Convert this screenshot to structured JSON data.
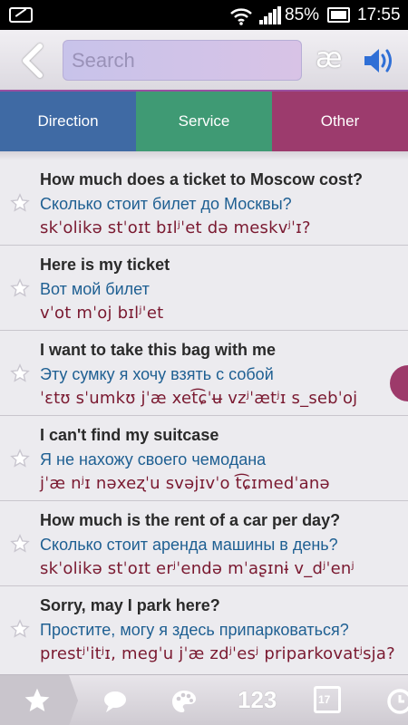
{
  "status_bar": {
    "battery_percent": "85%",
    "time": "17:55"
  },
  "toolbar": {
    "search_placeholder": "Search",
    "ipa_button_label": "æ"
  },
  "tabs": [
    {
      "label": "Direction",
      "color": "#3f6aa4"
    },
    {
      "label": "Service",
      "color": "#3f9a74"
    },
    {
      "label": "Other",
      "color": "#9c3b6d"
    }
  ],
  "phrases": [
    {
      "en": "How much does a ticket to Moscow cost?",
      "ru": "Сколько стоит билет до Москвы?",
      "tr": "skˈolikə stˈoɪt bɪlʲˈet də meskvʲˈɪ?"
    },
    {
      "en": "Here is my ticket",
      "ru": "Вот мой билет",
      "tr": "vˈot mˈoj bɪlʲˈet"
    },
    {
      "en": "I want to take this bag with me",
      "ru": "Эту сумку я хочу взять с собой",
      "tr": "ˈɛtʊ sˈumkʊ jˈæ xet͡ɕˈʉ vzʲˈætʲɪ s_sebˈoj"
    },
    {
      "en": "I can't find my suitcase",
      "ru": "Я не нахожу своего чемодана",
      "tr": "jˈæ nʲɪ nəxeʐˈu svəjɪvˈo t͡ɕɪmedˈanə"
    },
    {
      "en": "How much is the rent of a car per day?",
      "ru": "Сколько стоит аренда машины в день?",
      "tr": "skˈolikə stˈoɪt erʲˈendə mˈaʂɪnɨ v_dʲˈenʲ"
    },
    {
      "en": "Sorry, may I park here?",
      "ru": "Простите, могу я здесь припарковаться?",
      "tr": "prestʲˈitʲɪ, megˈu jˈæ zdʲˈesʲ priparkovatʲsja?"
    }
  ],
  "bottom_nav": [
    {
      "icon": "star-icon",
      "active": true
    },
    {
      "icon": "chat-icon",
      "active": false
    },
    {
      "icon": "palette-icon",
      "active": false
    },
    {
      "icon": "numbers-icon",
      "active": false,
      "label": "123"
    },
    {
      "icon": "calendar-icon",
      "active": false,
      "label": "17"
    },
    {
      "icon": "clock-icon",
      "active": false
    }
  ]
}
